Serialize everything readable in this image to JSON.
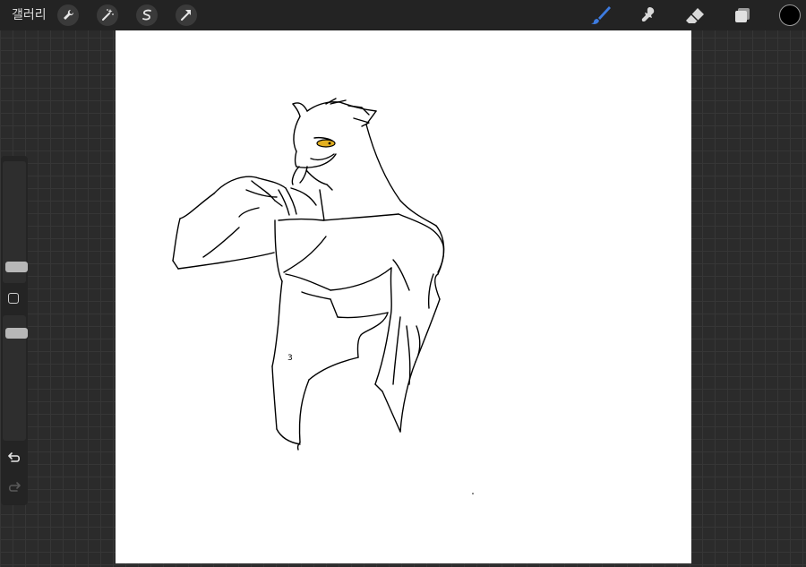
{
  "topbar": {
    "gallery_label": "갤러리",
    "left_tools": [
      "wrench-icon",
      "magic-wand-icon",
      "selection-icon",
      "transform-arrow-icon"
    ],
    "right_tools": [
      "brush-icon",
      "smudge-icon",
      "eraser-icon",
      "layers-icon"
    ],
    "active_tool": "brush-icon",
    "active_tool_color": "#3d7be0",
    "current_color": "#000000"
  },
  "sidebar": {
    "brush_size_level": 0.38,
    "opacity_level": 0.62,
    "modifier": "square-modifier-icon",
    "undo": "undo-icon",
    "redo": "redo-icon"
  },
  "canvas": {
    "background": "#ffffff",
    "stroke_color": "#000000",
    "eye_color": "#e3b020"
  }
}
